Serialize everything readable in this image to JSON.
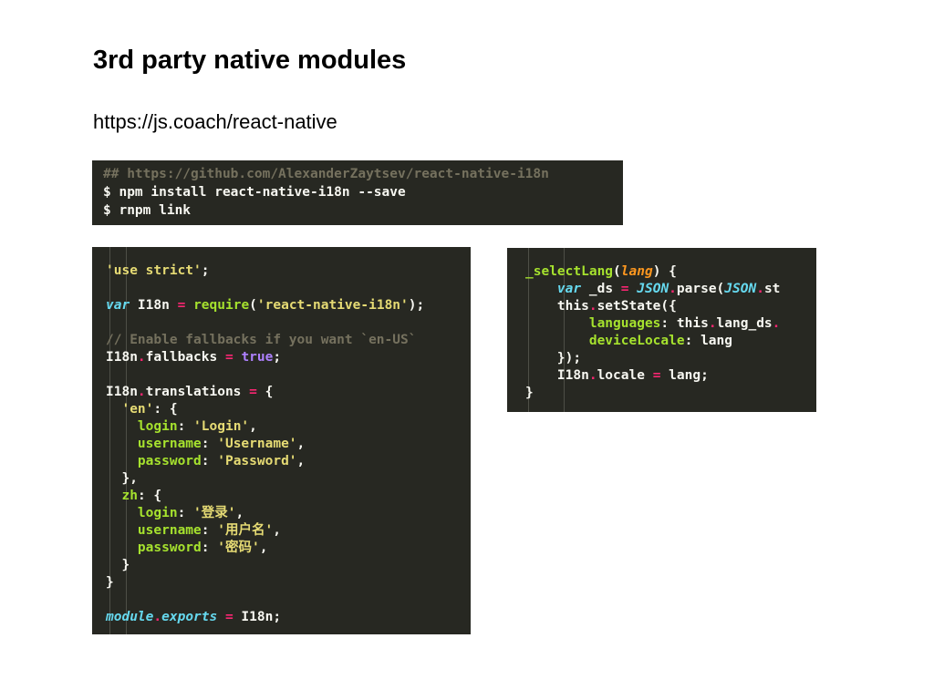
{
  "slide": {
    "title": "3rd party native modules",
    "link": "https://js.coach/react-native"
  },
  "terminal_snippet": [
    [
      [
        "c",
        "## https://github.com/AlexanderZaytsev/react-native-i18n"
      ]
    ],
    [
      [
        "t",
        "$ npm install react-native-i18n --save"
      ]
    ],
    [
      [
        "t",
        "$ rnpm link"
      ]
    ]
  ],
  "i18n_snippet": [
    [
      [
        "s",
        "'use strict'"
      ],
      [
        "t",
        ";"
      ]
    ],
    [],
    [
      [
        "k",
        "var"
      ],
      [
        "t",
        " I18n "
      ],
      [
        "o",
        "="
      ],
      [
        "t",
        " "
      ],
      [
        "f",
        "require"
      ],
      [
        "t",
        "("
      ],
      [
        "s",
        "'react-native-i18n'"
      ],
      [
        "t",
        ");"
      ]
    ],
    [],
    [
      [
        "c",
        "// Enable fallbacks if you want `en-US`"
      ]
    ],
    [
      [
        "t",
        "I18n"
      ],
      [
        "o",
        "."
      ],
      [
        "t",
        "fallbacks "
      ],
      [
        "o",
        "="
      ],
      [
        "t",
        " "
      ],
      [
        "b",
        "true"
      ],
      [
        "t",
        ";"
      ]
    ],
    [],
    [
      [
        "t",
        "I18n"
      ],
      [
        "o",
        "."
      ],
      [
        "t",
        "translations "
      ],
      [
        "o",
        "="
      ],
      [
        "t",
        " {"
      ]
    ],
    [
      [
        "t",
        "  "
      ],
      [
        "s",
        "'en'"
      ],
      [
        "t",
        ": {"
      ]
    ],
    [
      [
        "t",
        "    "
      ],
      [
        "f",
        "login"
      ],
      [
        "t",
        ": "
      ],
      [
        "s",
        "'Login'"
      ],
      [
        "t",
        ","
      ]
    ],
    [
      [
        "t",
        "    "
      ],
      [
        "f",
        "username"
      ],
      [
        "t",
        ": "
      ],
      [
        "s",
        "'Username'"
      ],
      [
        "t",
        ","
      ]
    ],
    [
      [
        "t",
        "    "
      ],
      [
        "f",
        "password"
      ],
      [
        "t",
        ": "
      ],
      [
        "s",
        "'Password'"
      ],
      [
        "t",
        ","
      ]
    ],
    [
      [
        "t",
        "  },"
      ]
    ],
    [
      [
        "t",
        "  "
      ],
      [
        "f",
        "zh"
      ],
      [
        "t",
        ": {"
      ]
    ],
    [
      [
        "t",
        "    "
      ],
      [
        "f",
        "login"
      ],
      [
        "t",
        ": "
      ],
      [
        "s",
        "'登录'"
      ],
      [
        "t",
        ","
      ]
    ],
    [
      [
        "t",
        "    "
      ],
      [
        "f",
        "username"
      ],
      [
        "t",
        ": "
      ],
      [
        "s",
        "'用户名'"
      ],
      [
        "t",
        ","
      ]
    ],
    [
      [
        "t",
        "    "
      ],
      [
        "f",
        "password"
      ],
      [
        "t",
        ": "
      ],
      [
        "s",
        "'密码'"
      ],
      [
        "t",
        ","
      ]
    ],
    [
      [
        "t",
        "  }"
      ]
    ],
    [
      [
        "t",
        "}"
      ]
    ],
    [],
    [
      [
        "k",
        "module"
      ],
      [
        "o",
        "."
      ],
      [
        "k",
        "exports"
      ],
      [
        "t",
        " "
      ],
      [
        "o",
        "="
      ],
      [
        "t",
        " I18n;"
      ]
    ]
  ],
  "select_lang_snippet": [
    [
      [
        "f",
        "_selectLang"
      ],
      [
        "t",
        "("
      ],
      [
        "p",
        "lang"
      ],
      [
        "t",
        ") {"
      ]
    ],
    [
      [
        "t",
        "    "
      ],
      [
        "k",
        "var"
      ],
      [
        "t",
        " _ds "
      ],
      [
        "o",
        "="
      ],
      [
        "t",
        " "
      ],
      [
        "j",
        "JSON"
      ],
      [
        "o",
        "."
      ],
      [
        "t",
        "parse("
      ],
      [
        "j",
        "JSON"
      ],
      [
        "o",
        "."
      ],
      [
        "t",
        "st"
      ]
    ],
    [
      [
        "t",
        "    this"
      ],
      [
        "o",
        "."
      ],
      [
        "t",
        "setState({"
      ]
    ],
    [
      [
        "t",
        "        "
      ],
      [
        "f",
        "languages"
      ],
      [
        "t",
        ": this"
      ],
      [
        "o",
        "."
      ],
      [
        "t",
        "lang_ds"
      ],
      [
        "o",
        "."
      ]
    ],
    [
      [
        "t",
        "        "
      ],
      [
        "f",
        "deviceLocale"
      ],
      [
        "t",
        ": lang"
      ]
    ],
    [
      [
        "t",
        "    });"
      ]
    ],
    [
      [
        "t",
        "    I18n"
      ],
      [
        "o",
        "."
      ],
      [
        "t",
        "locale "
      ],
      [
        "o",
        "="
      ],
      [
        "t",
        " lang;"
      ]
    ],
    [
      [
        "t",
        "}"
      ]
    ]
  ],
  "colors": {
    "code_background": "#272822",
    "plain": "#f8f8f2",
    "string": "#e6db74",
    "keyword": "#66d9ef",
    "operator": "#f92672",
    "comment": "#75715e",
    "boolean": "#ae81ff",
    "function": "#a6e22e",
    "parameter": "#fd971f"
  }
}
